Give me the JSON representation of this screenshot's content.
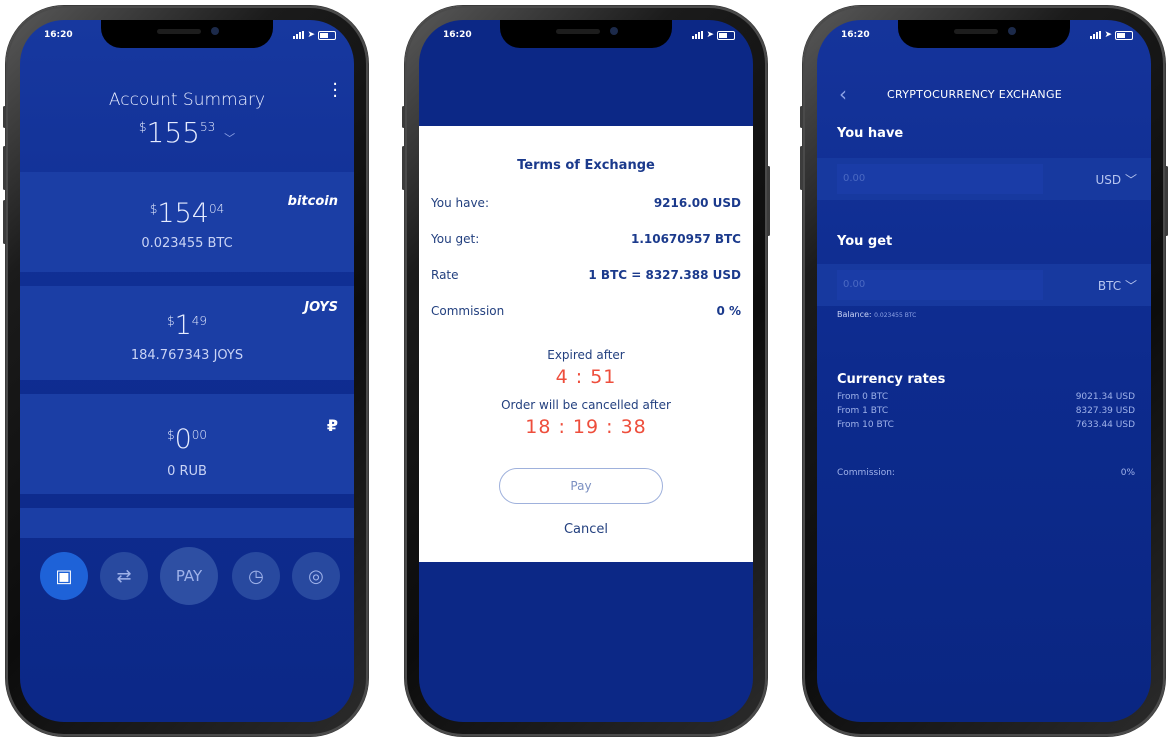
{
  "status": {
    "time": "16:20"
  },
  "screen1": {
    "title": "Account Summary",
    "total": {
      "main": "155",
      "cents": "53",
      "currency": "$"
    },
    "cards": [
      {
        "usd_main": "154",
        "usd_cents": "04",
        "sub": "0.023455 BTC",
        "logo": "bitcoin"
      },
      {
        "usd_main": "1",
        "usd_cents": "49",
        "sub": "184.767343 JOYS",
        "logo": "JOYS"
      },
      {
        "usd_main": "0",
        "usd_cents": "00",
        "sub": "0 RUB",
        "logo": "₽"
      }
    ],
    "nav": {
      "pay_label": "PAY"
    }
  },
  "screen2": {
    "dialog_title": "Terms of Exchange",
    "rows": [
      {
        "label": "You have:",
        "value": "9216.00 USD"
      },
      {
        "label": "You get:",
        "value": "1.10670957 BTC"
      },
      {
        "label": "Rate",
        "value": "1 BTC = 8327.388 USD"
      },
      {
        "label": "Commission",
        "value": "0 %"
      }
    ],
    "expired_label": "Expired after",
    "expired_timer": "4 : 51",
    "cancel_order_label": "Order will be cancelled after",
    "cancel_timer": "18 : 19 : 38",
    "pay_button": "Pay",
    "cancel_button": "Cancel"
  },
  "screen3": {
    "header": "CRYPTOCURRENCY EXCHANGE",
    "you_have_label": "You have",
    "you_have_placeholder": "0.00",
    "you_have_currency": "USD",
    "you_get_label": "You get",
    "you_get_placeholder": "0.00",
    "you_get_currency": "BTC",
    "balance_label": "Balance:",
    "balance_value": "0.023455 BTC",
    "rates_title": "Currency rates",
    "rates": [
      {
        "from": "From 0 BTC",
        "value": "9021.34 USD"
      },
      {
        "from": "From 1 BTC",
        "value": "8327.39 USD"
      },
      {
        "from": "From 10 BTC",
        "value": "7633.44 USD"
      }
    ],
    "commission_label": "Commission:",
    "commission_value": "0%"
  },
  "colors": {
    "primary_bg": "#0c2886",
    "accent_red": "#ee4e3c",
    "active_blue": "#1e62d8"
  }
}
